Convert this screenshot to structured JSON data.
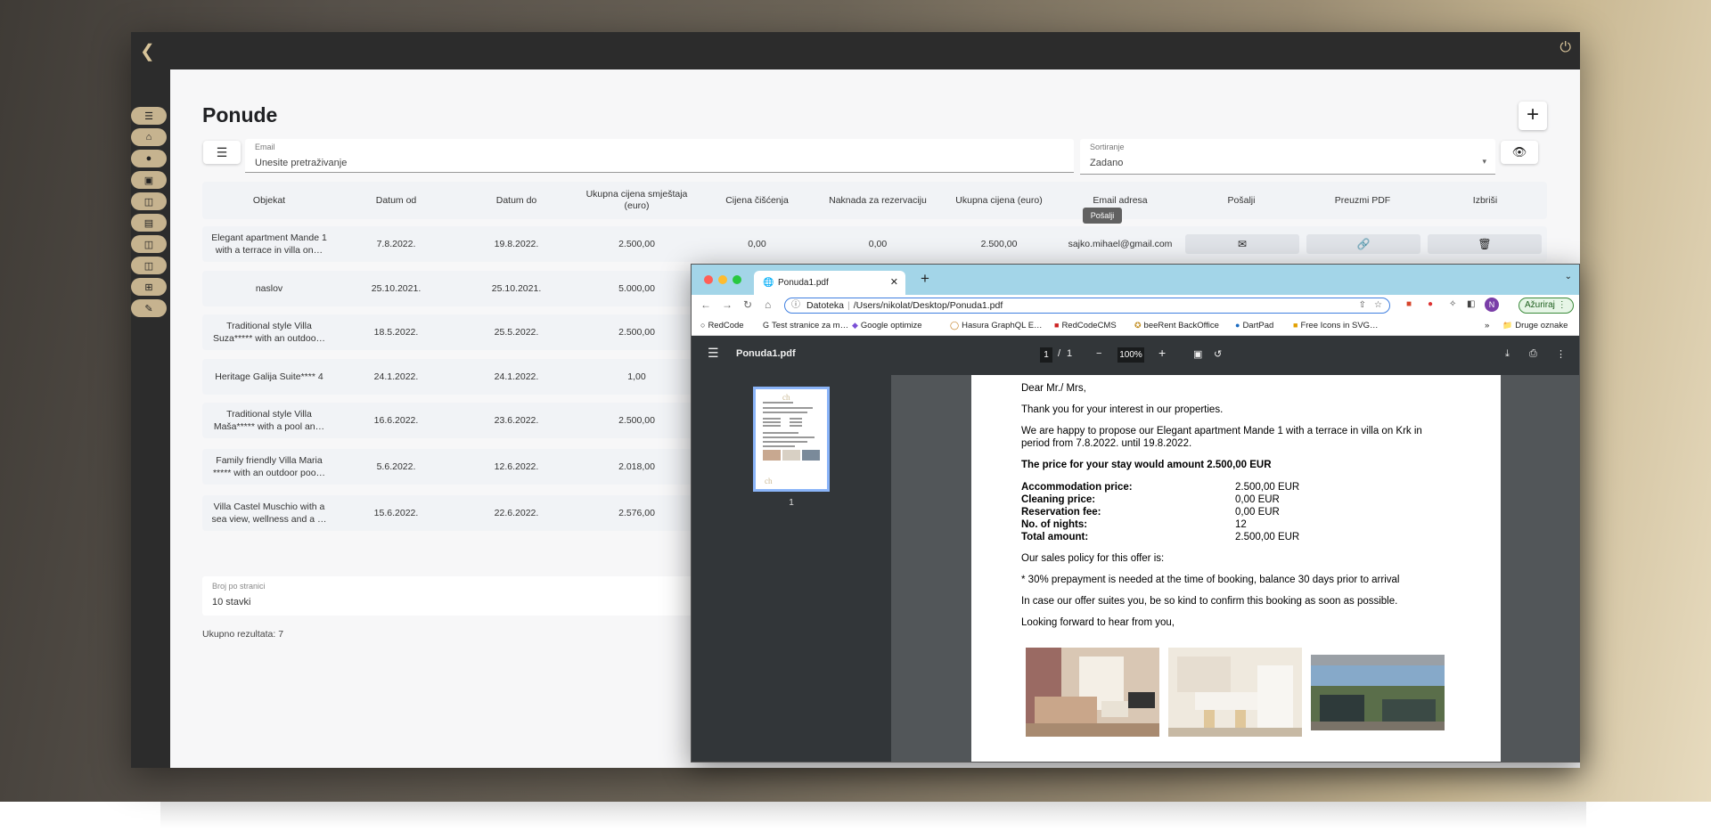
{
  "app": {
    "title": "Ponude",
    "search": {
      "label": "Email",
      "placeholder": "Unesite pretraživanje"
    },
    "sort": {
      "label": "Sortiranje",
      "value": "Zadano"
    },
    "columns": [
      "Objekat",
      "Datum od",
      "Datum do",
      "Ukupna cijena smještaja (euro)",
      "Cijena čišćenja",
      "Naknada za rezervaciju",
      "Ukupna cijena (euro)",
      "Email adresa",
      "Pošalji",
      "Preuzmi PDF",
      "Izbriši"
    ],
    "tooltip": "Pošalji",
    "rows": [
      {
        "objekat": "Elegant apartment Mande 1 with a terrace in villa on…",
        "od": "7.8.2022.",
        "do": "19.8.2022.",
        "smjestaj": "2.500,00",
        "ciscenje": "0,00",
        "naknada": "0,00",
        "ukupno": "2.500,00",
        "email": "sajko.mihael@gmail.com"
      },
      {
        "objekat": "naslov",
        "od": "25.10.2021.",
        "do": "25.10.2021.",
        "smjestaj": "5.000,00"
      },
      {
        "objekat": "Traditional style Villa Suza***** with an outdoo…",
        "od": "18.5.2022.",
        "do": "25.5.2022.",
        "smjestaj": "2.500,00"
      },
      {
        "objekat": "Heritage Galija Suite**** 4",
        "od": "24.1.2022.",
        "do": "24.1.2022.",
        "smjestaj": "1,00"
      },
      {
        "objekat": "Traditional style Villa Maša***** with a pool an…",
        "od": "16.6.2022.",
        "do": "23.6.2022.",
        "smjestaj": "2.500,00"
      },
      {
        "objekat": "Family friendly Villa Maria ***** with an outdoor poo…",
        "od": "5.6.2022.",
        "do": "12.6.2022.",
        "smjestaj": "2.018,00"
      },
      {
        "objekat": "Villa Castel Muschio with a sea view, wellness and a …",
        "od": "15.6.2022.",
        "do": "22.6.2022.",
        "smjestaj": "2.576,00"
      }
    ],
    "per_page": {
      "label": "Broj po stranici",
      "value": "10 stavki"
    },
    "total": "Ukupno rezultata: 7"
  },
  "browser": {
    "tab_title": "Ponuda1.pdf",
    "url_prefix": "Datoteka",
    "url": "/Users/nikolat/Desktop/Ponuda1.pdf",
    "update_label": "Ažuriraj",
    "avatar": "N",
    "bookmarks": [
      "RedCode",
      "Test stranice za m…",
      "Google optimize",
      "Hasura GraphQL E…",
      "RedCodeCMS",
      "beeRent BackOffice",
      "DartPad",
      "Free Icons in SVG…"
    ],
    "bookmarks_more": "»",
    "other_bookmarks": "Druge oznake",
    "pdf": {
      "filename": "Ponuda1.pdf",
      "page": "1",
      "page_sep": "/",
      "pages": "1",
      "zoom": "100%",
      "thumb_num": "1"
    }
  },
  "document": {
    "greeting": "Dear Mr./ Mrs,",
    "thanks": "Thank you for your interest in our properties.",
    "proposal_1": "We are happy to propose our Elegant apartment Mande 1 with a terrace in villa on Krk in",
    "proposal_2": "period from 7.8.2022. until 19.8.2022.",
    "price_line": "The price for your stay would amount 2.500,00 EUR",
    "prices": [
      {
        "k": "Accommodation price:",
        "v": "2.500,00 EUR"
      },
      {
        "k": "Cleaning price:",
        "v": "0,00 EUR"
      },
      {
        "k": "Reservation fee:",
        "v": "0,00 EUR"
      },
      {
        "k": "No. of nights:",
        "v": "12"
      },
      {
        "k": "Total amount:",
        "v": "2.500,00 EUR"
      }
    ],
    "policy_title": "Our sales policy for this offer is:",
    "policy": "* 30% prepayment is needed at the time of booking, balance 30 days prior to arrival",
    "confirm": "In case our offer suites you, be so kind to confirm this booking as soon as possible.",
    "closing": "Looking forward to hear from you,"
  },
  "colors": {
    "accent": "#c6b38f",
    "sidebar": "#2c2c2c",
    "tabbar": "#a3d5e8"
  }
}
